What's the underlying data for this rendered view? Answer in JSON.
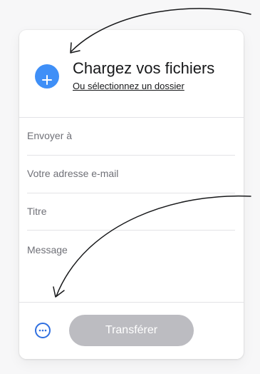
{
  "upload": {
    "title": "Chargez vos fichiers",
    "folder_link": "Ou sélectionnez un dossier",
    "add_icon": "plus-icon"
  },
  "form": {
    "recipient_placeholder": "Envoyer à",
    "email_placeholder": "Votre adresse e-mail",
    "title_placeholder": "Titre",
    "message_placeholder": "Message"
  },
  "footer": {
    "more_icon": "ellipsis-icon",
    "transfer_label": "Transférer"
  },
  "colors": {
    "accent_blue": "#3f8ff7",
    "more_blue": "#2f6fe0",
    "transfer_disabled": "#bcbcc1"
  }
}
